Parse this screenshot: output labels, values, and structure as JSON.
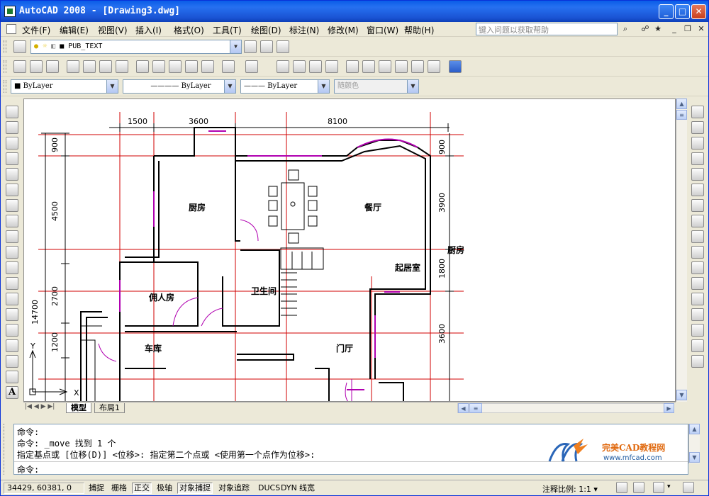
{
  "window": {
    "title": "AutoCAD 2008 - [Drawing3.dwg]",
    "min": "_",
    "max": "□",
    "close": "✕"
  },
  "menu": [
    "文件(F)",
    "编辑(E)",
    "视图(V)",
    "插入(I)",
    "格式(O)",
    "工具(T)",
    "绘图(D)",
    "标注(N)",
    "修改(M)",
    "窗口(W)",
    "帮助(H)"
  ],
  "help_placeholder": "键入问题以获取帮助",
  "layer": {
    "current": "PUB_TEXT"
  },
  "props": {
    "color": "ByLayer",
    "linetype": "ByLayer",
    "lineweight": "ByLayer",
    "plotstyle": "随颜色"
  },
  "tabs": [
    "模型",
    "布局1"
  ],
  "ucs": {
    "x": "X",
    "y": "Y"
  },
  "drawing": {
    "dims_top": [
      "1500",
      "3600",
      "8100"
    ],
    "dims_left": [
      "900",
      "4500",
      "2700",
      "1200",
      "14700"
    ],
    "dims_right": [
      "900",
      "3900",
      "1800",
      "3600"
    ],
    "rooms": [
      "厨房",
      "餐厅",
      "起居室",
      "佣人房",
      "卫生间",
      "车库",
      "门厅"
    ],
    "right_label": "厨房"
  },
  "command": {
    "lines": [
      "命令:",
      "命令: _move 找到 1 个",
      "指定基点或 [位移(D)] <位移>:  指定第二个点或 <使用第一个点作为位移>:",
      "命令:"
    ]
  },
  "watermark": {
    "title": "完美CAD教程网",
    "url": "www.mfcad.com"
  },
  "status": {
    "coords": "34429, 60381, 0",
    "toggles": [
      "捕捉",
      "栅格",
      "正交",
      "极轴",
      "对象捕捉",
      "对象追踪",
      "DUCS",
      "DYN",
      "线宽"
    ],
    "scale_label": "注释比例: 1:1 ▾"
  }
}
